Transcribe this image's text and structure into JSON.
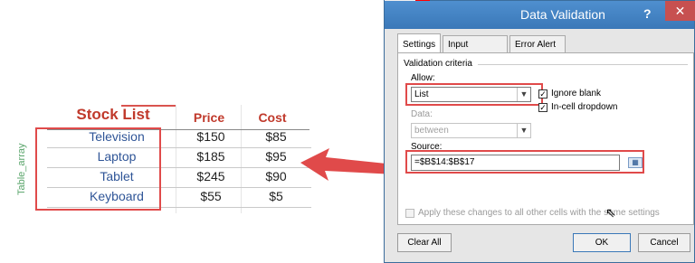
{
  "sheet": {
    "title": "Stock List",
    "col_price": "Price",
    "col_cost": "Cost",
    "side_label": "Table_array",
    "rows": [
      {
        "name": "Television",
        "price": "$150",
        "cost": "$85"
      },
      {
        "name": "Laptop",
        "price": "$185",
        "cost": "$95"
      },
      {
        "name": "Tablet",
        "price": "$245",
        "cost": "$90"
      },
      {
        "name": "Keyboard",
        "price": "$55",
        "cost": "$5"
      }
    ]
  },
  "dialog": {
    "title": "Data Validation",
    "help": "?",
    "close": "✕",
    "tabs": [
      "Settings",
      "Input Message",
      "Error Alert"
    ],
    "section_label": "Validation criteria",
    "allow_label": "Allow:",
    "allow_value": "List",
    "ignore_blank_label": "Ignore blank",
    "incell_dropdown_label": "In-cell dropdown",
    "data_label": "Data:",
    "data_value": "between",
    "source_label": "Source:",
    "source_value": "=$B$14:$B$17",
    "apply_all_label": "Apply these changes to all other cells with the same settings",
    "clear_all": "Clear All",
    "ok": "OK",
    "cancel": "Cancel"
  },
  "colors": {
    "annotation_red": "#e04a4a",
    "title_blue": "#3a78b8",
    "item_blue": "#2f5597"
  },
  "icons": {
    "dropdown": "chevron-down-icon",
    "range_select": "range-select-icon",
    "cursor": "pointer-cursor-icon"
  }
}
